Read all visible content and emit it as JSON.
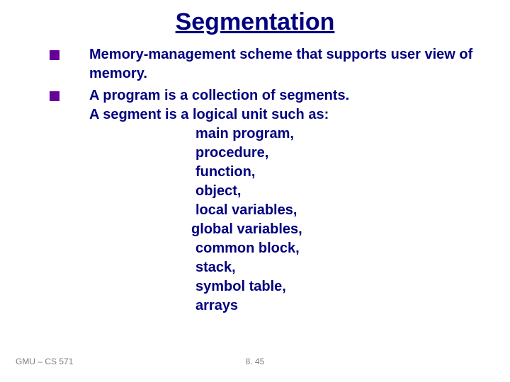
{
  "title": "Segmentation",
  "bullets": [
    {
      "text": "Memory-management scheme that supports user view of memory."
    },
    {
      "text_line1": "A program is a collection of segments.",
      "text_line2": "A segment is a logical unit such as:",
      "sublist": [
        "main program,",
        "procedure,",
        "function,",
        "object,",
        "local variables,",
        "global variables,",
        "common block,",
        "stack,",
        "symbol table,",
        "arrays"
      ]
    }
  ],
  "footer": {
    "left": "GMU – CS 571",
    "center": "8. 45"
  }
}
